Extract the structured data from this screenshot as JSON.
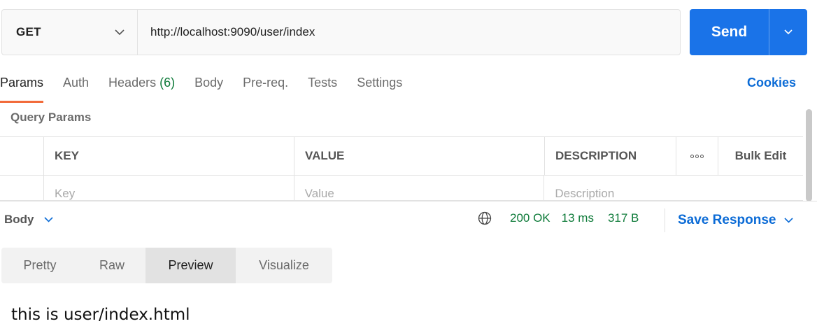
{
  "request": {
    "method": "GET",
    "url": "http://localhost:9090/user/index",
    "send_label": "Send"
  },
  "request_tabs": [
    {
      "label": "Params",
      "count": ""
    },
    {
      "label": "Auth",
      "count": ""
    },
    {
      "label": "Headers",
      "count": "(6)"
    },
    {
      "label": "Body",
      "count": ""
    },
    {
      "label": "Pre-req.",
      "count": ""
    },
    {
      "label": "Tests",
      "count": ""
    },
    {
      "label": "Settings",
      "count": ""
    }
  ],
  "active_tab": "Params",
  "cookies_label": "Cookies",
  "query_params": {
    "title": "Query Params",
    "headers": {
      "key": "KEY",
      "value": "VALUE",
      "description": "DESCRIPTION",
      "bulk_edit": "Bulk Edit"
    },
    "placeholders": {
      "key": "Key",
      "value": "Value",
      "description": "Description"
    }
  },
  "response": {
    "section_label": "Body",
    "status": "200 OK",
    "time": "13 ms",
    "size": "317 B",
    "save_label": "Save Response",
    "view_modes": [
      "Pretty",
      "Raw",
      "Preview",
      "Visualize"
    ],
    "active_mode": "Preview",
    "preview_text": "this is user/index.html"
  },
  "colors": {
    "accent": "#1a73e8",
    "link": "#0b6bd6",
    "success": "#0f7b3a",
    "active_tab_underline": "#f26b3a"
  },
  "icons": [
    "chevron-down-icon",
    "globe-icon",
    "more-icon"
  ]
}
